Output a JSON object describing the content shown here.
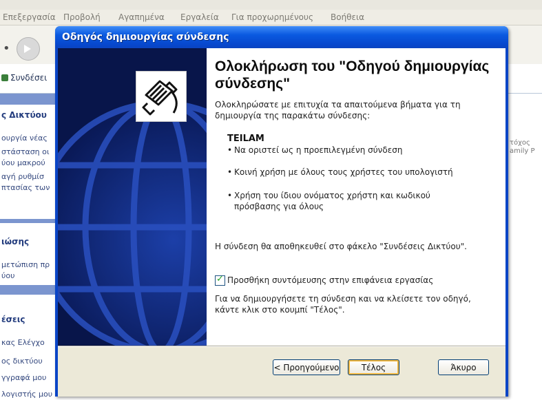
{
  "background_window": {
    "menu": [
      "Επεξεργασία",
      "Προβολή",
      "Αγαπημένα",
      "Εργαλεία",
      "Για προχωρημένους",
      "Βοήθεια"
    ],
    "connections_label": "Συνδέσει",
    "sidebar": {
      "network_tasks_title": "ς Δικτύου",
      "network_tasks_items": [
        "ουργία νέας",
        "στάσταση οι",
        "ύου μακρού",
        "αγή ρυθμίσ",
        "πτασίας των"
      ],
      "see_also_title": "ιώσης",
      "see_also_items": [
        "μετώπιση πρ",
        "ύου"
      ],
      "other_places_title": "έσεις",
      "other_places_items": [
        "κας Ελέγχο",
        "ος δικτύου",
        "γγραφά μου",
        "λογιστής μου"
      ]
    },
    "right_text": [
      "τόχος",
      "amily P"
    ]
  },
  "dialog": {
    "title": "Οδηγός δημιουργίας σύνδεσης",
    "heading": "Ολοκλήρωση του \"Οδηγού δημιουργίας σύνδεσης\"",
    "intro": "Ολοκληρώσατε με επιτυχία τα απαιτούμενα βήματα για τη δημιουργία της παρακάτω σύνδεσης:",
    "connection_name": "TEILAM",
    "bullets": [
      "Να οριστεί ως η προεπιλεγμένη σύνδεση",
      "Κοινή χρήση με όλους τους χρήστες του υπολογιστή",
      "Χρήση του ίδιου ονόματος χρήστη και κωδικού πρόσβασης για όλους"
    ],
    "saved_text": "Η σύνδεση θα αποθηκευθεί στο φάκελο \"Συνδέσεις Δικτύου\".",
    "checkbox_label": "Προσθήκη συντόμευσης στην επιφάνεια εργασίας",
    "checkbox_checked": true,
    "finish_text": "Για να δημιουργήσετε τη σύνδεση και να κλείσετε τον οδηγό, κάντε κλικ στο κουμπί \"Τέλος\".",
    "buttons": {
      "back": "< Προηγούμενο",
      "finish": "Τέλος",
      "cancel": "Άκυρο"
    },
    "icon": "network-cable-icon"
  },
  "colors": {
    "titlebar": "#0a59e0",
    "left_panel": "#08154a",
    "dialog_bg": "#ece9d8",
    "sidebar": "#7b95cf"
  }
}
